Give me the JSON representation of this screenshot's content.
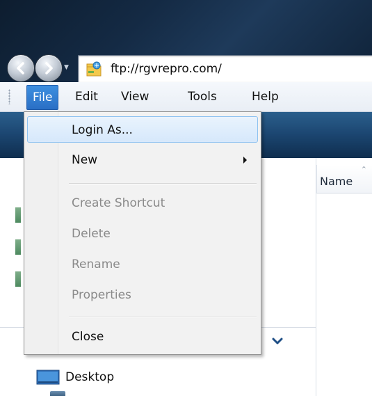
{
  "address": {
    "url": "ftp://rgvrepro.com/",
    "icon": "ftp-folder-icon"
  },
  "menubar": {
    "items": [
      "File",
      "Edit",
      "View",
      "Tools",
      "Help"
    ],
    "active": "File"
  },
  "file_menu": {
    "login_as": "Login As...",
    "new": "New",
    "create_shortcut": "Create Shortcut",
    "delete": "Delete",
    "rename": "Rename",
    "properties": "Properties",
    "close": "Close"
  },
  "navigation": {
    "desktop_label": "Desktop"
  },
  "content": {
    "column_name": "Name"
  },
  "colors": {
    "menu_active": "#2a6fc5",
    "highlight_border": "#8ec2f0",
    "disabled_text": "#8a8a8a"
  }
}
